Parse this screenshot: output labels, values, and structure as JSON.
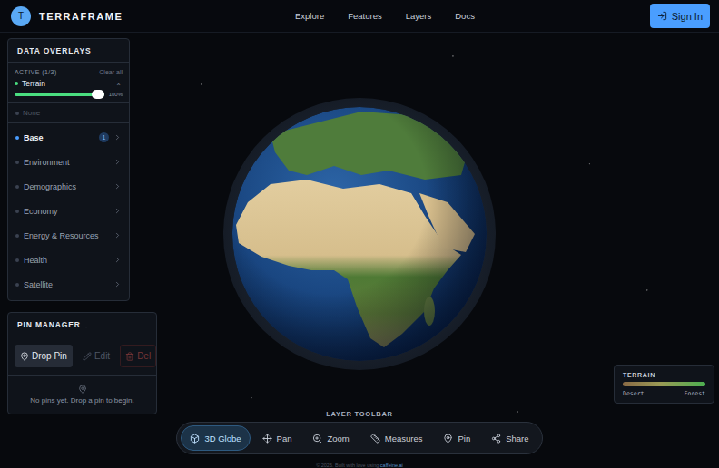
{
  "app": {
    "logo_letter": "T",
    "name": "TERRAFRAME"
  },
  "nav": [
    {
      "label": "Explore"
    },
    {
      "label": "Features"
    },
    {
      "label": "Layers"
    },
    {
      "label": "Docs"
    }
  ],
  "sign_in": {
    "label": "Sign In"
  },
  "overlays_panel": {
    "title": "DATA OVERLAYS",
    "active_label": "ACTIVE (1/3)",
    "clear_label": "Clear all",
    "active_layers": [
      {
        "name": "Terrain",
        "color": "#4ade80",
        "level": 1.0,
        "reading": "100%",
        "remove": "×"
      }
    ],
    "none_label": "None",
    "categories": [
      {
        "label": "Base",
        "selected": true,
        "badge": "1"
      },
      {
        "label": "Environment",
        "selected": false,
        "badge": ""
      },
      {
        "label": "Demographics",
        "selected": false,
        "badge": ""
      },
      {
        "label": "Economy",
        "selected": false,
        "badge": ""
      },
      {
        "label": "Energy & Resources",
        "selected": false,
        "badge": ""
      },
      {
        "label": "Health",
        "selected": false,
        "badge": ""
      },
      {
        "label": "Satellite",
        "selected": false,
        "badge": ""
      }
    ]
  },
  "pin_manager": {
    "title": "PIN MANAGER",
    "buttons": [
      {
        "label": "Drop Pin",
        "disabled": false,
        "kind": "primary"
      },
      {
        "label": "Edit",
        "disabled": true,
        "kind": "default"
      },
      {
        "label": "Del",
        "disabled": true,
        "kind": "danger"
      }
    ],
    "empty_text": "No pins yet. Drop a pin to begin."
  },
  "legend": {
    "title": "TERRAIN",
    "low": "Desert",
    "high": "Forest"
  },
  "toolbar": {
    "title": "LAYER TOOLBAR",
    "items": [
      {
        "label": "3D Globe",
        "selected": true
      },
      {
        "label": "Pan",
        "selected": false
      },
      {
        "label": "Zoom",
        "selected": false
      },
      {
        "label": "Measures",
        "selected": false
      },
      {
        "label": "Pin",
        "selected": false
      },
      {
        "label": "Share",
        "selected": false
      }
    ]
  },
  "footer": {
    "text": "© 2026. Built with love using ",
    "link": "caffeine.ai"
  }
}
